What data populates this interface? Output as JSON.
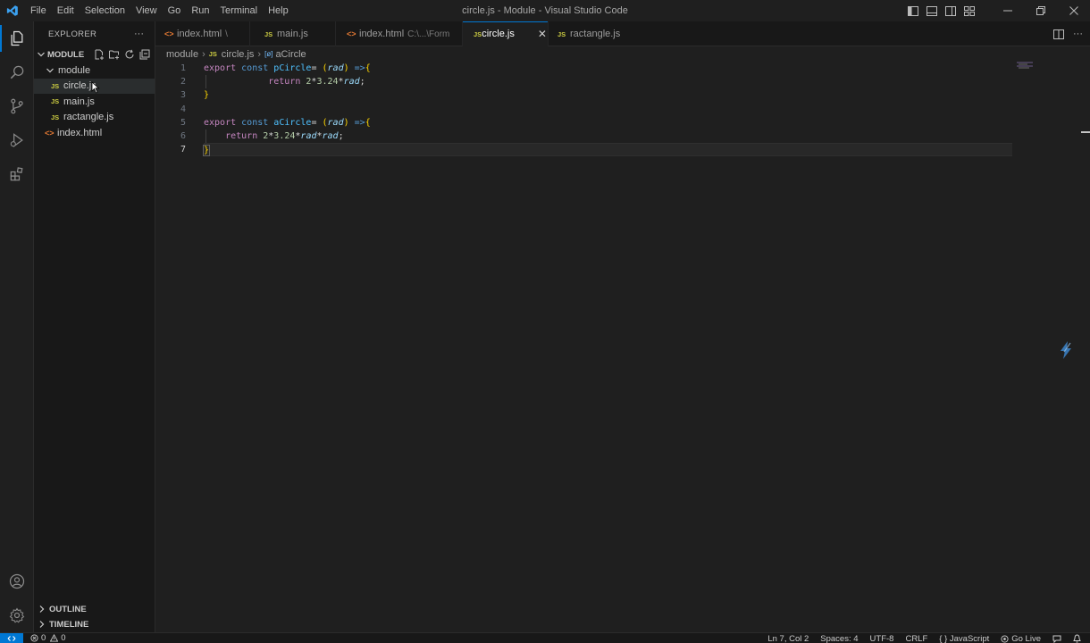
{
  "window_title": "circle.js - Module - Visual Studio Code",
  "menu": [
    "File",
    "Edit",
    "Selection",
    "View",
    "Go",
    "Run",
    "Terminal",
    "Help"
  ],
  "sidebar": {
    "title": "EXPLORER",
    "more": "···",
    "section": "MODULE",
    "folder": "module",
    "files": [
      "circle.js",
      "main.js",
      "ractangle.js"
    ],
    "root_file": "index.html",
    "outline": "OUTLINE",
    "timeline": "TIMELINE"
  },
  "tabs": [
    {
      "label": "index.html",
      "desc": "\\",
      "type": "html"
    },
    {
      "label": "main.js",
      "desc": "",
      "type": "js"
    },
    {
      "label": "index.html",
      "desc": "C:\\...\\Form",
      "type": "html"
    },
    {
      "label": "circle.js",
      "desc": "",
      "type": "js",
      "active": true
    },
    {
      "label": "ractangle.js",
      "desc": "",
      "type": "js"
    }
  ],
  "tab_close": "✕",
  "breadcrumb": {
    "folder": "module",
    "file": "circle.js",
    "symbol": "aCircle",
    "symbol_icon": "[ø]"
  },
  "js_badge": "JS",
  "html_badge": "<>",
  "code": {
    "line_numbers": [
      "1",
      "2",
      "3",
      "4",
      "5",
      "6",
      "7"
    ],
    "l1": {
      "export": "export",
      "const": "const",
      "name": "pCircle",
      "eq": "= ",
      "open": "(",
      "param": "rad",
      "close": ")",
      "arrow": " =>",
      "brace": "{"
    },
    "l2": {
      "ret": "return",
      "expr_a": " 2",
      "op1": "*",
      "num": "3.24",
      "op2": "*",
      "param": "rad",
      "semi": ";"
    },
    "l3": {
      "brace": "}"
    },
    "l5": {
      "export": "export",
      "const": "const",
      "name": "aCircle",
      "eq": "= ",
      "open": "(",
      "param": "rad",
      "close": ")",
      "arrow": " =>",
      "brace": "{"
    },
    "l6": {
      "ret": "return",
      "expr_a": " 2",
      "op1": "*",
      "num": "3.24",
      "op2": "*",
      "param": "rad",
      "op3": "*",
      "param2": "rad",
      "semi": ";"
    },
    "l7": {
      "brace": "}"
    }
  },
  "status": {
    "errors": "0",
    "warnings": "0",
    "position": "Ln 7, Col 2",
    "spaces": "Spaces: 4",
    "encoding": "UTF-8",
    "eol": "CRLF",
    "language": "{ } JavaScript",
    "golive": "Go Live"
  },
  "colors": {
    "accent": "#0078d4",
    "js": "#cbcb41",
    "html": "#e37933"
  }
}
